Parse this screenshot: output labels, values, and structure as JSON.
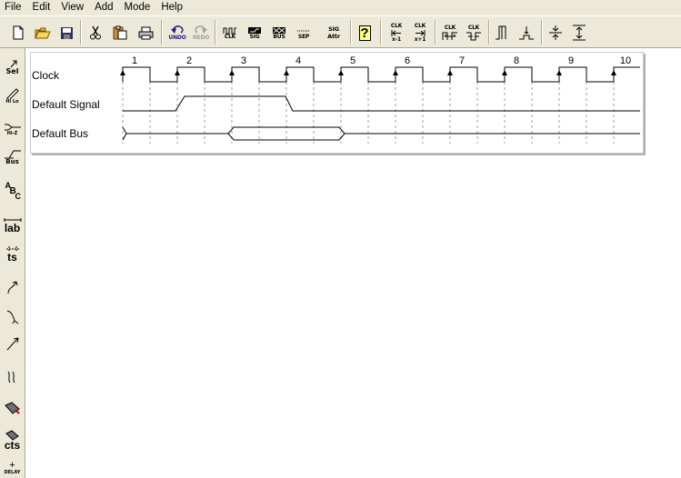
{
  "menu": [
    "File",
    "Edit",
    "View",
    "Add",
    "Mode",
    "Help"
  ],
  "toolbar": {
    "undo_label": "UNDO",
    "redo_label": "REDO",
    "clk_label": "CLK",
    "sig_label": "SIG",
    "bus_label": "BUS",
    "sep_label": "SEP",
    "sig_attr_label_1": "SIG",
    "sig_attr_label_2": "Attr",
    "help_glyph": "?",
    "clk_minus_label_1": "CLK",
    "clk_minus_label_2": "x-1",
    "clk_plus_label_1": "CLK",
    "clk_plus_label_2": "x+1",
    "clk_a_label": "CLK",
    "clk_b_label": "CLK"
  },
  "palette": {
    "sel_label": "Sel",
    "hilo_label": "Hi Lo",
    "hiz_label": "Hi-Z",
    "bus_label": "Bus",
    "abc_a": "A",
    "abc_b": "B",
    "abc_c": "C",
    "lab_label": "lab",
    "ts_label": "ts",
    "cts_label": "cts",
    "delay_label": "DELAY",
    "plus_glyph": "+"
  },
  "timing": {
    "signals": [
      {
        "name": "Clock",
        "type": "clock"
      },
      {
        "name": "Default Signal",
        "type": "signal",
        "high_from_cycle": 2,
        "high_to_cycle": 4
      },
      {
        "name": "Default Bus",
        "type": "bus",
        "value_change_cycles": [
          3,
          5
        ]
      }
    ],
    "clock_edge_numbers": [
      "1",
      "2",
      "3",
      "4",
      "5",
      "6",
      "7",
      "8",
      "9",
      "10"
    ]
  },
  "colors": {
    "chrome": "#ece9d8",
    "canvas": "#ffffff",
    "waveform": "#000000",
    "gridline": "#a0a0a0"
  }
}
